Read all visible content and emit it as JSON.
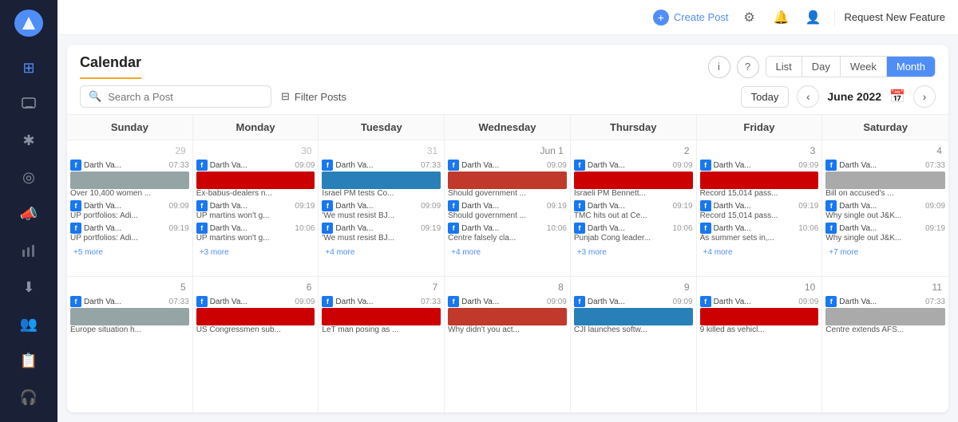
{
  "sidebar": {
    "logo": "◀",
    "items": [
      {
        "icon": "⊞",
        "name": "dashboard",
        "label": "Dashboard"
      },
      {
        "icon": "💬",
        "name": "messages",
        "label": "Messages"
      },
      {
        "icon": "✱",
        "name": "analytics",
        "label": "Analytics"
      },
      {
        "icon": "◎",
        "name": "publish",
        "label": "Publish"
      },
      {
        "icon": "📣",
        "name": "campaigns",
        "label": "Campaigns"
      },
      {
        "icon": "📊",
        "name": "reports",
        "label": "Reports"
      },
      {
        "icon": "⬇",
        "name": "download",
        "label": "Download"
      },
      {
        "icon": "👥",
        "name": "team",
        "label": "Team"
      },
      {
        "icon": "📋",
        "name": "content",
        "label": "Content"
      },
      {
        "icon": "🎧",
        "name": "support",
        "label": "Support"
      }
    ]
  },
  "topbar": {
    "create_post_label": "Create Post",
    "request_feature_label": "Request New Feature"
  },
  "calendar": {
    "title": "Calendar",
    "view_buttons": [
      "List",
      "Day",
      "Week",
      "Month"
    ],
    "active_view": "Month",
    "search_placeholder": "Search a Post",
    "filter_label": "Filter Posts",
    "today_label": "Today",
    "current_month": "June 2022",
    "days": [
      "Sunday",
      "Monday",
      "Tuesday",
      "Wednesday",
      "Thursday",
      "Friday",
      "Saturday"
    ],
    "week1": {
      "dates": [
        "29",
        "30",
        "31",
        "Jun 1",
        "2",
        "3",
        "4"
      ],
      "date_classes": [
        "gray",
        "gray",
        "gray",
        "",
        "",
        "",
        ""
      ],
      "posts": [
        [
          {
            "time": "07:33",
            "name": "Darth Va...",
            "title": "Over 10,400 women ...",
            "thumb": "gray"
          },
          {
            "time": "09:09",
            "name": "Darth Va...",
            "title": "UP portfolios: Adi...",
            "thumb": "orange"
          },
          {
            "time": "09:19",
            "name": "Darth Va...",
            "title": "UP portfolios: Adi...",
            "thumb": "orange"
          },
          {
            "more": "+5 more"
          }
        ],
        [
          {
            "time": "09:09",
            "name": "Darth Va...",
            "title": "Ex-babus-dealers n...",
            "thumb": "toi"
          },
          {
            "time": "09:19",
            "name": "Darth Va...",
            "title": "UP martins won't g...",
            "thumb": "toi"
          },
          {
            "time": "10:06",
            "name": "Darth Va...",
            "title": "UP martins won't g...",
            "thumb": "toi"
          },
          {
            "more": "+3 more"
          }
        ],
        [
          {
            "time": "07:33",
            "name": "Darth Va...",
            "title": "Israel PM tests Co...",
            "thumb": "blue"
          },
          {
            "time": "09:09",
            "name": "Darth Va...",
            "title": "'We must resist BJ...",
            "thumb": "gray"
          },
          {
            "time": "09:19",
            "name": "Darth Va...",
            "title": "'We must resist BJ...",
            "thumb": "gray"
          },
          {
            "more": "+4 more"
          }
        ],
        [
          {
            "time": "09:09",
            "name": "Darth Va...",
            "title": "Should government ...",
            "thumb": "red"
          },
          {
            "time": "09:19",
            "name": "Darth Va...",
            "title": "Should government ...",
            "thumb": "red"
          },
          {
            "time": "10:06",
            "name": "Darth Va...",
            "title": "Centre falsely cla...",
            "thumb": "gray"
          },
          {
            "more": "+4 more"
          }
        ],
        [
          {
            "time": "09:09",
            "name": "Darth Va...",
            "title": "Israeli PM Bennett...",
            "thumb": "toi"
          },
          {
            "time": "09:19",
            "name": "Darth Va...",
            "title": "TMC hits out at Ce...",
            "thumb": "blue"
          },
          {
            "time": "10:06",
            "name": "Darth Va...",
            "title": "Punjab Cong leader...",
            "thumb": "blue"
          },
          {
            "more": "+3 more"
          }
        ],
        [
          {
            "time": "09:09",
            "name": "Darth Va...",
            "title": "Record 15,014 pass...",
            "thumb": "toi"
          },
          {
            "time": "09:19",
            "name": "Darth Va...",
            "title": "Record 15,014 pass...",
            "thumb": "toi"
          },
          {
            "time": "10:06",
            "name": "Darth Va...",
            "title": "As summer sets in,...",
            "thumb": "gray"
          },
          {
            "more": "+4 more"
          }
        ],
        [
          {
            "time": "07:33",
            "name": "Darth Va...",
            "title": "Bill on accused's ...",
            "thumb": "gray"
          },
          {
            "time": "09:09",
            "name": "Darth Va...",
            "title": "Why single out J&K...",
            "thumb": "gray"
          },
          {
            "time": "09:19",
            "name": "Darth Va...",
            "title": "Why single out J&K...",
            "thumb": "gray"
          },
          {
            "more": "+7 more"
          }
        ]
      ]
    },
    "week2": {
      "dates": [
        "5",
        "6",
        "7",
        "8",
        "9",
        "10",
        "11"
      ],
      "posts": [
        [
          {
            "time": "07:33",
            "name": "Darth Va...",
            "title": "Europe situation h...",
            "thumb": "gray"
          }
        ],
        [
          {
            "time": "09:09",
            "name": "Darth Va...",
            "title": "US Congressmen sub...",
            "thumb": "toi"
          }
        ],
        [
          {
            "time": "07:33",
            "name": "Darth Va...",
            "title": "LeT man posing as ...",
            "thumb": "toi"
          }
        ],
        [
          {
            "time": "09:09",
            "name": "Darth Va...",
            "title": "Why didn't you act...",
            "thumb": "red"
          }
        ],
        [
          {
            "time": "09:09",
            "name": "Darth Va...",
            "title": "CJI launches softw...",
            "thumb": "blue"
          }
        ],
        [
          {
            "time": "09:09",
            "name": "Darth Va...",
            "title": "9 killed as vehicl...",
            "thumb": "toi"
          }
        ],
        [
          {
            "time": "07:33",
            "name": "Darth Va...",
            "title": "Centre extends AFS...",
            "thumb": "gray"
          }
        ]
      ]
    }
  }
}
